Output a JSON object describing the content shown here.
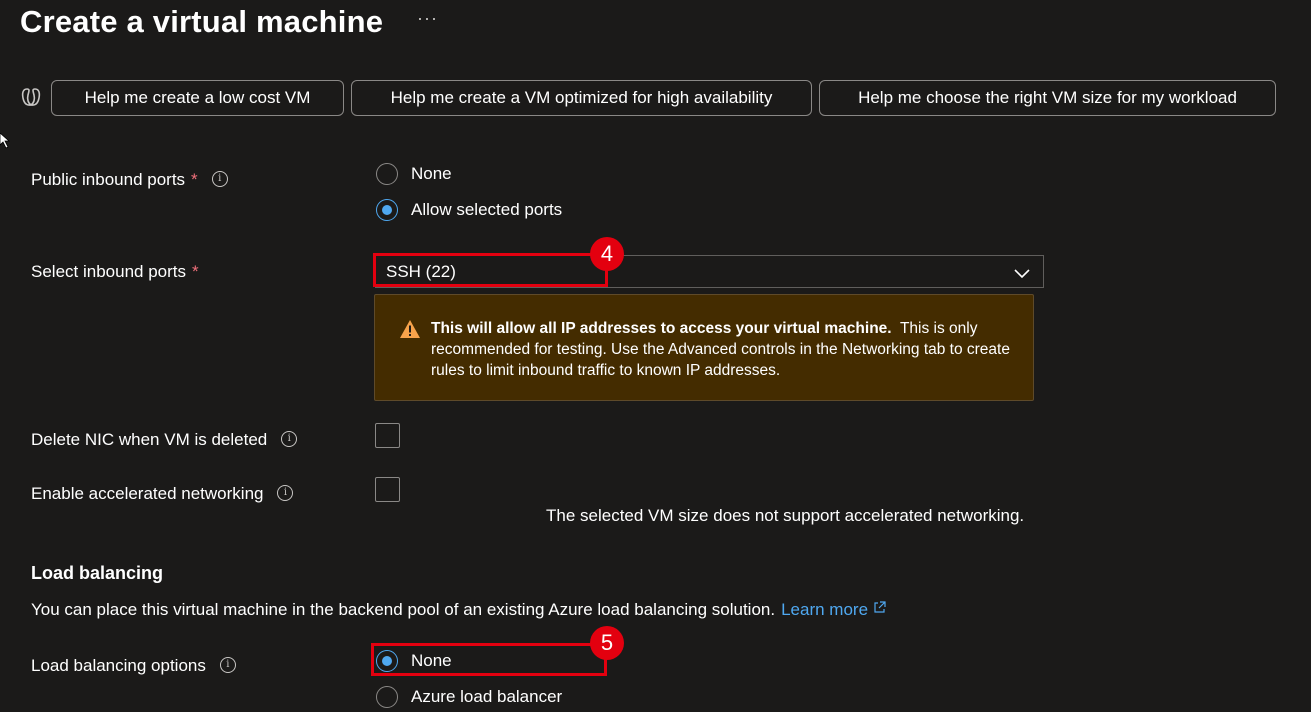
{
  "page": {
    "title": "Create a virtual machine",
    "more_label": "···"
  },
  "suggestions": [
    {
      "label": "Help me create a low cost VM"
    },
    {
      "label": "Help me create a VM optimized for high availability"
    },
    {
      "label": "Help me choose the right VM size for my workload"
    }
  ],
  "public_inbound_ports": {
    "label": "Public inbound ports",
    "required_mark": "*",
    "options": [
      {
        "label": "None",
        "checked": false
      },
      {
        "label": "Allow selected ports",
        "checked": true
      }
    ]
  },
  "select_inbound_ports": {
    "label": "Select inbound ports",
    "required_mark": "*",
    "value": "SSH (22)"
  },
  "warning": {
    "bold_text": "This will allow all IP addresses to access your virtual machine.",
    "text": "This is only recommended for testing.  Use the Advanced controls in the Networking tab to create rules to limit inbound traffic to known IP addresses."
  },
  "delete_nic": {
    "label": "Delete NIC when VM is deleted",
    "checked": false
  },
  "accelerated_networking": {
    "label": "Enable accelerated networking",
    "checked": false,
    "note": "The selected VM size does not support accelerated networking."
  },
  "load_balancing": {
    "heading": "Load balancing",
    "description": "You can place this virtual machine in the backend pool of an existing Azure load balancing solution.",
    "learn_more": "Learn more",
    "options_label": "Load balancing options",
    "options": [
      {
        "label": "None",
        "checked": true
      },
      {
        "label": "Azure load balancer",
        "checked": false
      }
    ]
  },
  "annotations": {
    "badge_4": "4",
    "badge_5": "5"
  },
  "colors": {
    "background": "#1b1a19",
    "accent": "#4fa8f0",
    "callout": "#e3000f",
    "warning_bg": "#442c00"
  }
}
